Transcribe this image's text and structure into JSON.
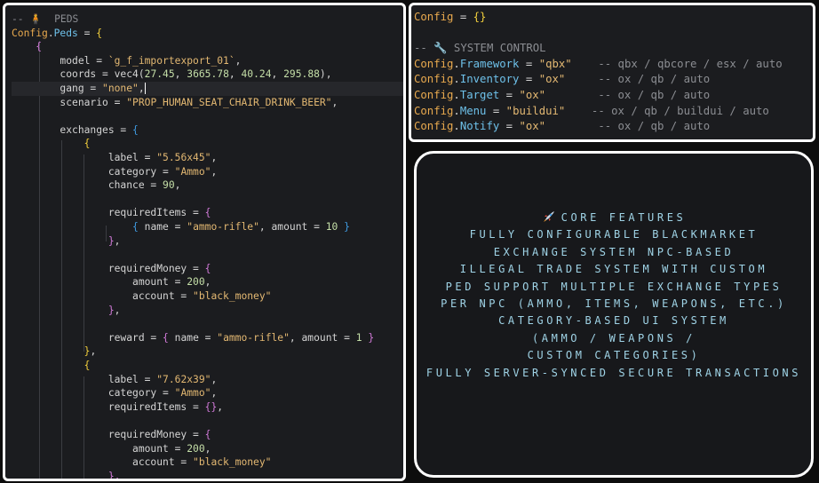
{
  "left_editor": {
    "lines": [
      [
        [
          "cm",
          "-- "
        ],
        [
          "kw",
          "🧍"
        ],
        [
          "cm",
          "  PEDS"
        ]
      ],
      [
        [
          "kw",
          "Config"
        ],
        [
          "",
          "."
        ],
        [
          "pr",
          "Peds"
        ],
        [
          "",
          " = "
        ],
        [
          "br",
          "{"
        ]
      ],
      [
        [
          "",
          "    "
        ],
        [
          "br2",
          "{"
        ]
      ],
      [
        [
          "",
          "        model = "
        ],
        [
          "st",
          "`g_f_importexport_01`"
        ],
        [
          "",
          ","
        ]
      ],
      [
        [
          "",
          "        coords = vec4("
        ],
        [
          "nu",
          "27.45"
        ],
        [
          "",
          ", "
        ],
        [
          "nu",
          "3665.78"
        ],
        [
          "",
          ", "
        ],
        [
          "nu",
          "40.24"
        ],
        [
          "",
          ", "
        ],
        [
          "nu",
          "295.88"
        ],
        [
          "",
          "),"
        ]
      ],
      [
        [
          "",
          "        gang = "
        ],
        [
          "st",
          "\"none\""
        ],
        [
          "",
          ","
        ]
      ],
      [
        [
          "",
          "        scenario = "
        ],
        [
          "st",
          "\"PROP_HUMAN_SEAT_CHAIR_DRINK_BEER\""
        ],
        [
          "",
          ","
        ]
      ],
      [],
      [
        [
          "",
          "        exchanges = "
        ],
        [
          "br3",
          "{"
        ]
      ],
      [
        [
          "",
          "            "
        ],
        [
          "br",
          "{"
        ]
      ],
      [
        [
          "",
          "                label = "
        ],
        [
          "st",
          "\"5.56x45\""
        ],
        [
          "",
          ","
        ]
      ],
      [
        [
          "",
          "                category = "
        ],
        [
          "st",
          "\"Ammo\""
        ],
        [
          "",
          ","
        ]
      ],
      [
        [
          "",
          "                chance = "
        ],
        [
          "nu",
          "90"
        ],
        [
          "",
          ","
        ]
      ],
      [],
      [
        [
          "",
          "                requiredItems = "
        ],
        [
          "br2",
          "{"
        ]
      ],
      [
        [
          "",
          "                    "
        ],
        [
          "br3",
          "{"
        ],
        [
          "",
          " name = "
        ],
        [
          "st",
          "\"ammo-rifle\""
        ],
        [
          "",
          ", amount = "
        ],
        [
          "nu",
          "10"
        ],
        [
          "",
          " "
        ],
        [
          "br3",
          "}"
        ]
      ],
      [
        [
          "",
          "                "
        ],
        [
          "br2",
          "}"
        ],
        [
          "",
          ","
        ]
      ],
      [],
      [
        [
          "",
          "                requiredMoney = "
        ],
        [
          "br2",
          "{"
        ]
      ],
      [
        [
          "",
          "                    amount = "
        ],
        [
          "nu",
          "200"
        ],
        [
          "",
          ","
        ]
      ],
      [
        [
          "",
          "                    account = "
        ],
        [
          "st",
          "\"black_money\""
        ]
      ],
      [
        [
          "",
          "                "
        ],
        [
          "br2",
          "}"
        ],
        [
          "",
          ","
        ]
      ],
      [],
      [
        [
          "",
          "                reward = "
        ],
        [
          "br2",
          "{"
        ],
        [
          "",
          " name = "
        ],
        [
          "st",
          "\"ammo-rifle\""
        ],
        [
          "",
          ", amount = "
        ],
        [
          "nu",
          "1"
        ],
        [
          "",
          " "
        ],
        [
          "br2",
          "}"
        ]
      ],
      [
        [
          "",
          "            "
        ],
        [
          "br",
          "}"
        ],
        [
          "",
          ","
        ]
      ],
      [
        [
          "",
          "            "
        ],
        [
          "br",
          "{"
        ]
      ],
      [
        [
          "",
          "                label = "
        ],
        [
          "st",
          "\"7.62x39\""
        ],
        [
          "",
          ","
        ]
      ],
      [
        [
          "",
          "                category = "
        ],
        [
          "st",
          "\"Ammo\""
        ],
        [
          "",
          ","
        ]
      ],
      [
        [
          "",
          "                requiredItems = "
        ],
        [
          "br2",
          "{}"
        ],
        [
          "",
          ","
        ]
      ],
      [],
      [
        [
          "",
          "                requiredMoney = "
        ],
        [
          "br2",
          "{"
        ]
      ],
      [
        [
          "",
          "                    amount = "
        ],
        [
          "nu",
          "200"
        ],
        [
          "",
          ","
        ]
      ],
      [
        [
          "",
          "                    account = "
        ],
        [
          "st",
          "\"black_money\""
        ]
      ],
      [
        [
          "",
          "                "
        ],
        [
          "br2",
          "},"
        ]
      ]
    ]
  },
  "right_editor": {
    "lines": [
      [
        [
          "kw",
          "Config"
        ],
        [
          "",
          " = "
        ],
        [
          "br",
          "{}"
        ]
      ],
      [],
      [
        [
          "cm",
          "-- "
        ],
        [
          "kw",
          "🔧"
        ],
        [
          "cm",
          " SYSTEM CONTROL"
        ]
      ],
      [
        [
          "kw",
          "Config"
        ],
        [
          "",
          "."
        ],
        [
          "pr",
          "Framework"
        ],
        [
          "",
          " = "
        ],
        [
          "st",
          "\"qbx\""
        ],
        [
          "cm",
          "    -- qbx / qbcore / esx / auto"
        ]
      ],
      [
        [
          "kw",
          "Config"
        ],
        [
          "",
          "."
        ],
        [
          "pr",
          "Inventory"
        ],
        [
          "",
          " = "
        ],
        [
          "st",
          "\"ox\""
        ],
        [
          "cm",
          "     -- ox / qb / auto"
        ]
      ],
      [
        [
          "kw",
          "Config"
        ],
        [
          "",
          "."
        ],
        [
          "pr",
          "Target"
        ],
        [
          "",
          " = "
        ],
        [
          "st",
          "\"ox\""
        ],
        [
          "cm",
          "        -- ox / qb / auto"
        ]
      ],
      [
        [
          "kw",
          "Config"
        ],
        [
          "",
          "."
        ],
        [
          "pr",
          "Menu"
        ],
        [
          "",
          " = "
        ],
        [
          "st",
          "\"buildui\""
        ],
        [
          "cm",
          "    -- ox / qb / buildui / auto"
        ]
      ],
      [
        [
          "kw",
          "Config"
        ],
        [
          "",
          "."
        ],
        [
          "pr",
          "Notify"
        ],
        [
          "",
          " = "
        ],
        [
          "st",
          "\"ox\""
        ],
        [
          "cm",
          "        -- ox / qb / auto"
        ]
      ]
    ]
  },
  "features": {
    "lines": [
      "core features",
      "Fully configurable blackmarket",
      "exchange system NPC-based",
      "illegal trade system with custom",
      "ped support Multiple exchange types",
      "per NPC (ammo, items, weapons, etc.)",
      "Category-based UI system",
      "(Ammo / Weapons /",
      "custom categories)",
      "Fully server-synced secure transactions"
    ],
    "icon": "rocket-icon"
  }
}
